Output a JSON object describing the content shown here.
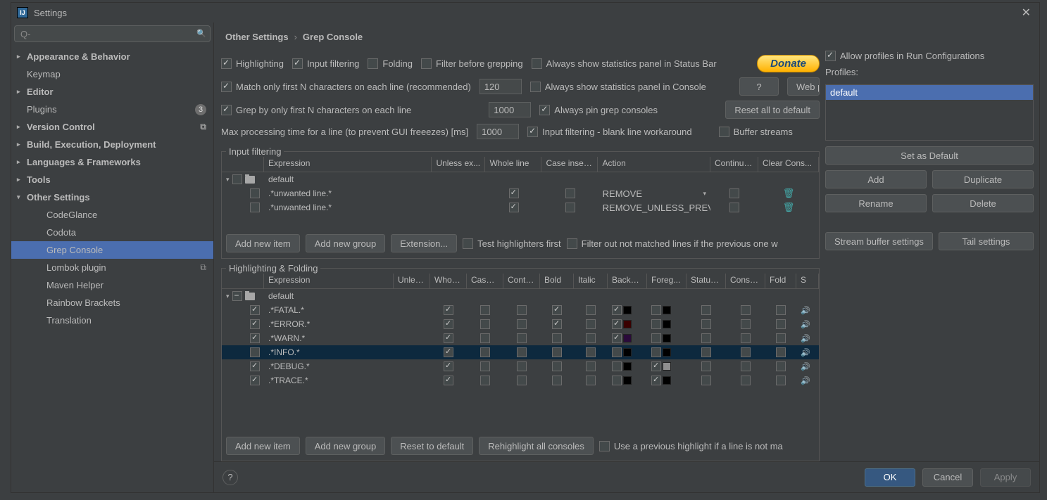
{
  "window": {
    "title": "Settings"
  },
  "search_placeholder": "Q-",
  "tree": {
    "items": [
      {
        "label": "Appearance & Behavior",
        "arrow": "collapsed",
        "bold": true
      },
      {
        "label": "Keymap",
        "arrow": ""
      },
      {
        "label": "Editor",
        "arrow": "collapsed",
        "bold": true
      },
      {
        "label": "Plugins",
        "arrow": "",
        "badge": "3"
      },
      {
        "label": "Version Control",
        "arrow": "collapsed",
        "bold": true,
        "proj": true
      },
      {
        "label": "Build, Execution, Deployment",
        "arrow": "collapsed",
        "bold": true
      },
      {
        "label": "Languages & Frameworks",
        "arrow": "collapsed",
        "bold": true
      },
      {
        "label": "Tools",
        "arrow": "collapsed",
        "bold": true
      },
      {
        "label": "Other Settings",
        "arrow": "expanded",
        "bold": true
      },
      {
        "label": "CodeGlance",
        "sub": true
      },
      {
        "label": "Codota",
        "sub": true
      },
      {
        "label": "Grep Console",
        "sub": true,
        "selected": true
      },
      {
        "label": "Lombok plugin",
        "sub": true,
        "proj": true
      },
      {
        "label": "Maven Helper",
        "sub": true
      },
      {
        "label": "Rainbow Brackets",
        "sub": true
      },
      {
        "label": "Translation",
        "sub": true
      }
    ]
  },
  "breadcrumb": {
    "a": "Other Settings",
    "b": "Grep Console"
  },
  "opts": {
    "highlighting": "Highlighting",
    "input_filtering": "Input filtering",
    "folding": "Folding",
    "filter_before": "Filter before grepping",
    "always_statusbar": "Always show statistics panel in Status Bar",
    "match_first_n": "Match only first N characters on each line (recommended)",
    "match_first_n_val": "120",
    "always_console": "Always show statistics panel in Console",
    "help": "?",
    "webp": "Web p",
    "grep_first_n": "Grep by only first N characters on each line",
    "grep_first_n_val": "1000",
    "always_pin": "Always pin grep consoles",
    "reset_all": "Reset all to default",
    "max_time": "Max processing time for a line (to prevent GUI freeezes) [ms]",
    "max_time_val": "1000",
    "blank_workaround": "Input filtering - blank line workaround",
    "buffer_streams": "Buffer streams",
    "donate": "Donate"
  },
  "input_filtering": {
    "legend": "Input filtering",
    "headers": [
      "",
      "Expression",
      "Unless ex...",
      "Whole line",
      "Case insen...",
      "Action",
      "Continue ...",
      "Clear Cons..."
    ],
    "group": "default",
    "rows": [
      {
        "expr": ".*unwanted line.*",
        "whole": true,
        "action": "REMOVE"
      },
      {
        "expr": ".*unwanted line.*",
        "whole": true,
        "action": "REMOVE_UNLESS_PREVIO..."
      }
    ],
    "add_item": "Add new item",
    "add_group": "Add new group",
    "extension": "Extension...",
    "test_hl": "Test highlighters first",
    "filter_out": "Filter out not matched lines if the previous one w"
  },
  "highlighting": {
    "legend": "Highlighting & Folding",
    "headers": [
      "",
      "Expression",
      "Unles...",
      "Whole...",
      "Case i...",
      "Contin...",
      "Bold",
      "Italic",
      "Backg...",
      "Foreg...",
      "Status...",
      "Conso...",
      "Fold",
      "S"
    ],
    "group": "default",
    "rows": [
      {
        "on": true,
        "expr": ".*FATAL.*",
        "whole": true,
        "bold": true,
        "bg_on": true,
        "bg": "#000000",
        "fg_on": false,
        "fg": "#000000"
      },
      {
        "on": true,
        "expr": ".*ERROR.*",
        "whole": true,
        "bold": true,
        "bg_on": true,
        "bg": "#3a0000",
        "fg_on": false,
        "fg": "#000000"
      },
      {
        "on": true,
        "expr": ".*WARN.*",
        "whole": true,
        "bg_on": true,
        "bg": "#2a0a3a",
        "fg_on": false,
        "fg": "#000000"
      },
      {
        "on": false,
        "expr": ".*INFO.*",
        "whole": true,
        "bg_on": false,
        "bg": "#000000",
        "fg_on": false,
        "fg": "#000000",
        "sel": true
      },
      {
        "on": true,
        "expr": ".*DEBUG.*",
        "whole": true,
        "bg_on": false,
        "bg": "#000000",
        "fg_on": true,
        "fg": "#8f8f8f"
      },
      {
        "on": true,
        "expr": ".*TRACE.*",
        "whole": true,
        "bg_on": false,
        "bg": "#000000",
        "fg_on": true,
        "fg": "#000000"
      }
    ],
    "add_item": "Add new item",
    "add_group": "Add new group",
    "reset": "Reset to default",
    "rehighlight": "Rehighlight all consoles",
    "use_prev": "Use a previous highlight if a line is not ma"
  },
  "profiles": {
    "allow": "Allow profiles in Run Configurations",
    "label": "Profiles:",
    "items": [
      "default"
    ],
    "set_default": "Set as Default",
    "add": "Add",
    "duplicate": "Duplicate",
    "rename": "Rename",
    "delete": "Delete",
    "stream": "Stream buffer settings",
    "tail": "Tail settings"
  },
  "footer": {
    "ok": "OK",
    "cancel": "Cancel",
    "apply": "Apply"
  }
}
